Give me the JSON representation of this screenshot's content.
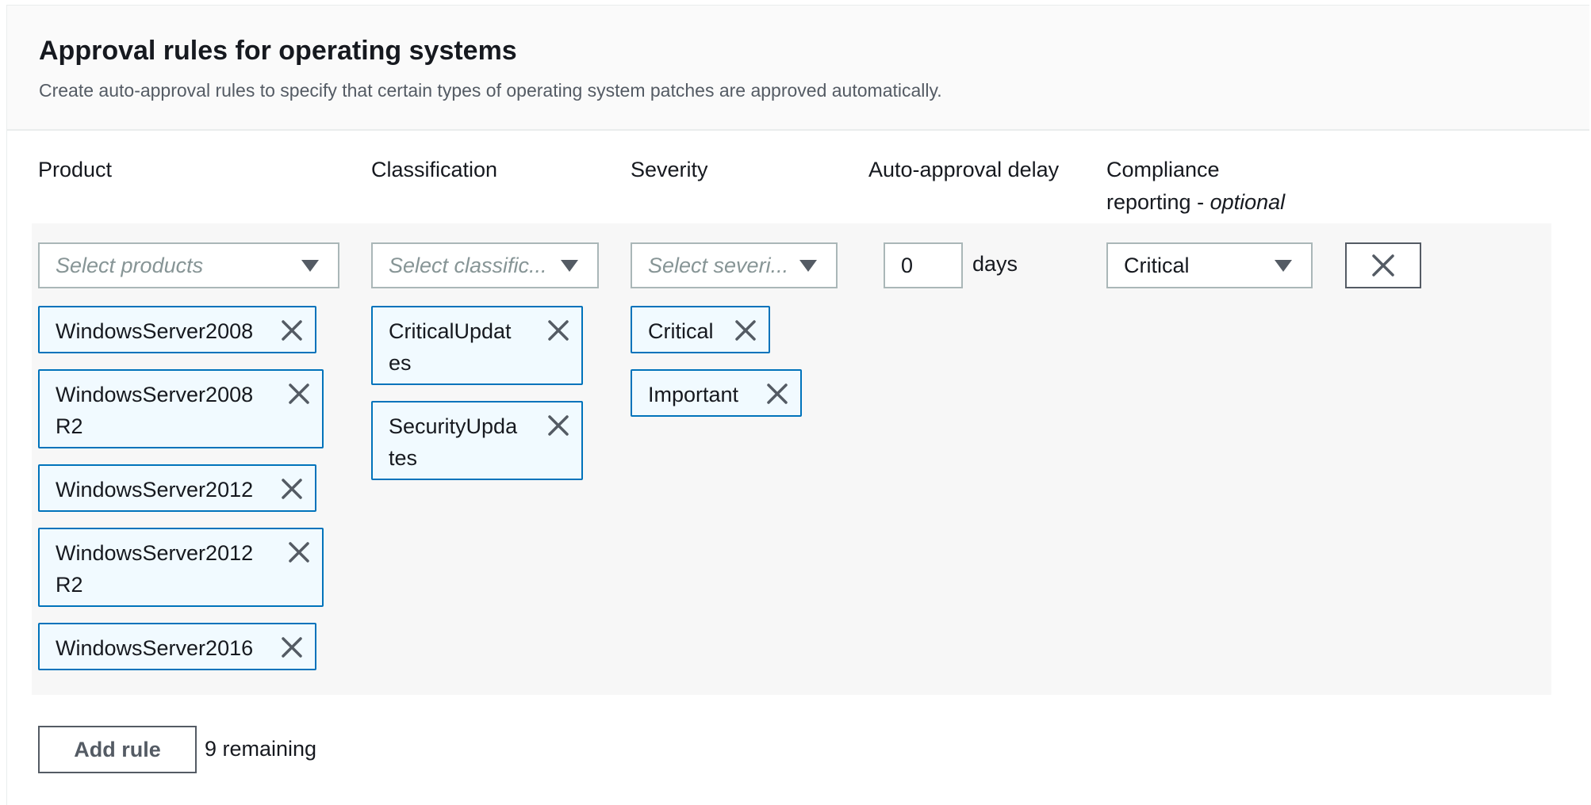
{
  "header": {
    "title": "Approval rules for operating systems",
    "description": "Create auto-approval rules to specify that certain types of operating system patches are approved automatically."
  },
  "columns": {
    "product": "Product",
    "classification": "Classification",
    "severity": "Severity",
    "delay": "Auto-approval delay",
    "compliance_line1": "Compliance",
    "compliance_line2": "reporting - ",
    "compliance_optional": "optional"
  },
  "rule": {
    "product_placeholder": "Select products",
    "classification_placeholder": "Select classific...",
    "severity_placeholder": "Select severi...",
    "delay_value": "0",
    "delay_unit": "days",
    "compliance_value": "Critical",
    "products": [
      [
        "WindowsServer2008"
      ],
      [
        "WindowsServer2008",
        "R2"
      ],
      [
        "WindowsServer2012"
      ],
      [
        "WindowsServer2012",
        "R2"
      ],
      [
        "WindowsServer2016"
      ]
    ],
    "classifications": [
      [
        "CriticalUpdat",
        "es"
      ],
      [
        "SecurityUpda",
        "tes"
      ]
    ],
    "severities": [
      "Critical",
      "Important"
    ]
  },
  "footer": {
    "add_rule_label": "Add rule",
    "remaining_text": "9 remaining"
  },
  "icons": {
    "dropdown": "chevron-down-icon",
    "remove": "close-icon"
  },
  "colors": {
    "token_border": "#0073bb",
    "token_bg": "#f1faff",
    "input_border": "#aab7b8",
    "row_bg": "#f7f7f7"
  }
}
